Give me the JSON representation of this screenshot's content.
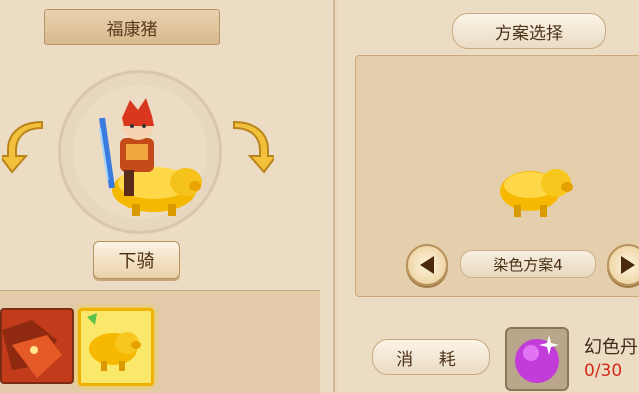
{
  "mount": {
    "title": "福康猪",
    "dismount_label": "下骑"
  },
  "scheme": {
    "title": "方案选择",
    "current_name": "染色方案4"
  },
  "consume": {
    "label": "消 耗",
    "item_name": "幻色丹",
    "item_count": "0/30"
  },
  "icons": {
    "left_rotate": "rotate-left-arrow-icon",
    "right_rotate": "rotate-right-arrow-icon",
    "prev": "triangle-left-icon",
    "next": "triangle-right-icon"
  }
}
